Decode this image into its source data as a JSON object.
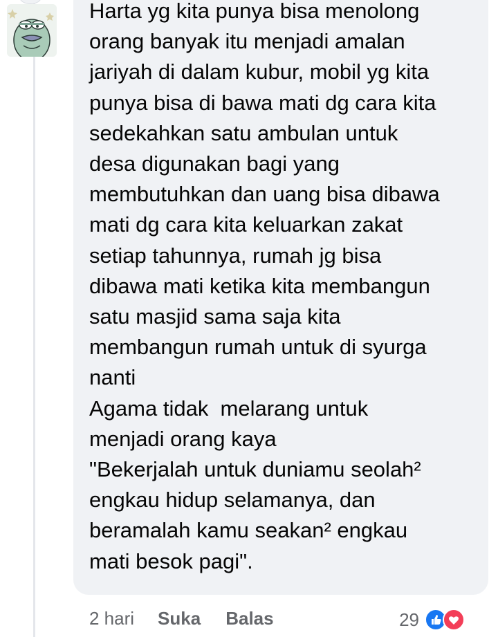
{
  "comment": {
    "author_avatar_icon": "cartoon-avatar",
    "text": "Harta yg kita punya bisa menolong\norang banyak itu menjadi amalan\njariyah di dalam kubur, mobil yg kita\npunya bisa di bawa mati dg cara kita\nsedekahkan satu ambulan untuk\ndesa digunakan bagi yang\nmembutuhkan dan uang bisa dibawa\nmati dg cara kita keluarkan zakat\nsetiap tahunnya, rumah jg bisa\ndibawa mati ketika kita membangun\nsatu masjid sama saja kita\nmembangun rumah untuk di syurga\nnanti\nAgama tidak  melarang untuk\nmenjadi orang kaya\n\"Bekerjalah untuk duniamu seolah²\nengkau hidup selamanya, dan\nberamalah kamu seakan² engkau\nmati besok pagi\".",
    "time": "2 hari",
    "like_label": "Suka",
    "reply_label": "Balas",
    "reaction_count": "29",
    "reaction_icons": [
      "like-icon",
      "love-icon"
    ]
  },
  "colors": {
    "bubble_bg": "#f0f2f5",
    "text": "#050505",
    "meta_text": "#65676b",
    "like_blue": "#1877f2",
    "love_red": "#f33e58"
  }
}
